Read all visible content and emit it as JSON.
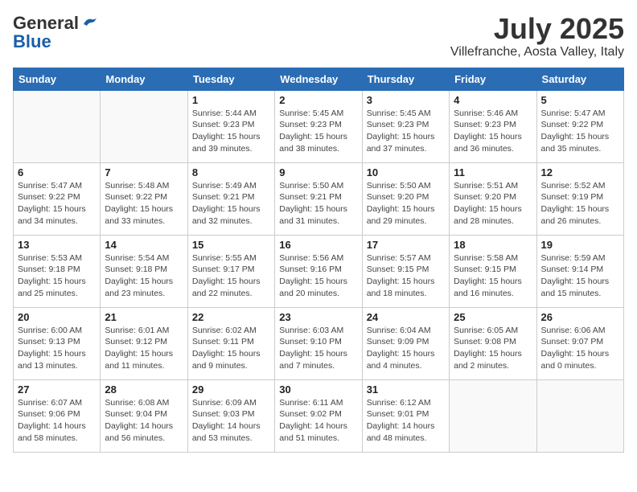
{
  "header": {
    "logo_general": "General",
    "logo_blue": "Blue",
    "title": "July 2025",
    "subtitle": "Villefranche, Aosta Valley, Italy"
  },
  "days_of_week": [
    "Sunday",
    "Monday",
    "Tuesday",
    "Wednesday",
    "Thursday",
    "Friday",
    "Saturday"
  ],
  "weeks": [
    [
      {
        "day": "",
        "detail": ""
      },
      {
        "day": "",
        "detail": ""
      },
      {
        "day": "1",
        "detail": "Sunrise: 5:44 AM\nSunset: 9:23 PM\nDaylight: 15 hours\nand 39 minutes."
      },
      {
        "day": "2",
        "detail": "Sunrise: 5:45 AM\nSunset: 9:23 PM\nDaylight: 15 hours\nand 38 minutes."
      },
      {
        "day": "3",
        "detail": "Sunrise: 5:45 AM\nSunset: 9:23 PM\nDaylight: 15 hours\nand 37 minutes."
      },
      {
        "day": "4",
        "detail": "Sunrise: 5:46 AM\nSunset: 9:23 PM\nDaylight: 15 hours\nand 36 minutes."
      },
      {
        "day": "5",
        "detail": "Sunrise: 5:47 AM\nSunset: 9:22 PM\nDaylight: 15 hours\nand 35 minutes."
      }
    ],
    [
      {
        "day": "6",
        "detail": "Sunrise: 5:47 AM\nSunset: 9:22 PM\nDaylight: 15 hours\nand 34 minutes."
      },
      {
        "day": "7",
        "detail": "Sunrise: 5:48 AM\nSunset: 9:22 PM\nDaylight: 15 hours\nand 33 minutes."
      },
      {
        "day": "8",
        "detail": "Sunrise: 5:49 AM\nSunset: 9:21 PM\nDaylight: 15 hours\nand 32 minutes."
      },
      {
        "day": "9",
        "detail": "Sunrise: 5:50 AM\nSunset: 9:21 PM\nDaylight: 15 hours\nand 31 minutes."
      },
      {
        "day": "10",
        "detail": "Sunrise: 5:50 AM\nSunset: 9:20 PM\nDaylight: 15 hours\nand 29 minutes."
      },
      {
        "day": "11",
        "detail": "Sunrise: 5:51 AM\nSunset: 9:20 PM\nDaylight: 15 hours\nand 28 minutes."
      },
      {
        "day": "12",
        "detail": "Sunrise: 5:52 AM\nSunset: 9:19 PM\nDaylight: 15 hours\nand 26 minutes."
      }
    ],
    [
      {
        "day": "13",
        "detail": "Sunrise: 5:53 AM\nSunset: 9:18 PM\nDaylight: 15 hours\nand 25 minutes."
      },
      {
        "day": "14",
        "detail": "Sunrise: 5:54 AM\nSunset: 9:18 PM\nDaylight: 15 hours\nand 23 minutes."
      },
      {
        "day": "15",
        "detail": "Sunrise: 5:55 AM\nSunset: 9:17 PM\nDaylight: 15 hours\nand 22 minutes."
      },
      {
        "day": "16",
        "detail": "Sunrise: 5:56 AM\nSunset: 9:16 PM\nDaylight: 15 hours\nand 20 minutes."
      },
      {
        "day": "17",
        "detail": "Sunrise: 5:57 AM\nSunset: 9:15 PM\nDaylight: 15 hours\nand 18 minutes."
      },
      {
        "day": "18",
        "detail": "Sunrise: 5:58 AM\nSunset: 9:15 PM\nDaylight: 15 hours\nand 16 minutes."
      },
      {
        "day": "19",
        "detail": "Sunrise: 5:59 AM\nSunset: 9:14 PM\nDaylight: 15 hours\nand 15 minutes."
      }
    ],
    [
      {
        "day": "20",
        "detail": "Sunrise: 6:00 AM\nSunset: 9:13 PM\nDaylight: 15 hours\nand 13 minutes."
      },
      {
        "day": "21",
        "detail": "Sunrise: 6:01 AM\nSunset: 9:12 PM\nDaylight: 15 hours\nand 11 minutes."
      },
      {
        "day": "22",
        "detail": "Sunrise: 6:02 AM\nSunset: 9:11 PM\nDaylight: 15 hours\nand 9 minutes."
      },
      {
        "day": "23",
        "detail": "Sunrise: 6:03 AM\nSunset: 9:10 PM\nDaylight: 15 hours\nand 7 minutes."
      },
      {
        "day": "24",
        "detail": "Sunrise: 6:04 AM\nSunset: 9:09 PM\nDaylight: 15 hours\nand 4 minutes."
      },
      {
        "day": "25",
        "detail": "Sunrise: 6:05 AM\nSunset: 9:08 PM\nDaylight: 15 hours\nand 2 minutes."
      },
      {
        "day": "26",
        "detail": "Sunrise: 6:06 AM\nSunset: 9:07 PM\nDaylight: 15 hours\nand 0 minutes."
      }
    ],
    [
      {
        "day": "27",
        "detail": "Sunrise: 6:07 AM\nSunset: 9:06 PM\nDaylight: 14 hours\nand 58 minutes."
      },
      {
        "day": "28",
        "detail": "Sunrise: 6:08 AM\nSunset: 9:04 PM\nDaylight: 14 hours\nand 56 minutes."
      },
      {
        "day": "29",
        "detail": "Sunrise: 6:09 AM\nSunset: 9:03 PM\nDaylight: 14 hours\nand 53 minutes."
      },
      {
        "day": "30",
        "detail": "Sunrise: 6:11 AM\nSunset: 9:02 PM\nDaylight: 14 hours\nand 51 minutes."
      },
      {
        "day": "31",
        "detail": "Sunrise: 6:12 AM\nSunset: 9:01 PM\nDaylight: 14 hours\nand 48 minutes."
      },
      {
        "day": "",
        "detail": ""
      },
      {
        "day": "",
        "detail": ""
      }
    ]
  ]
}
